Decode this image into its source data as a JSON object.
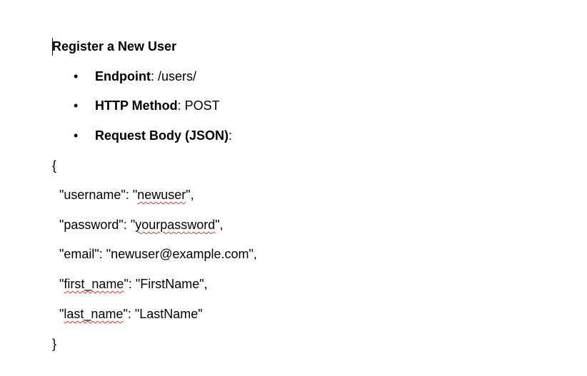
{
  "document": {
    "heading": "Register a New User",
    "bullets": [
      {
        "label": "Endpoint",
        "value": ": /users/"
      },
      {
        "label": "HTTP Method",
        "value": ": POST"
      },
      {
        "label": "Request Body (JSON)",
        "value": ":"
      }
    ],
    "json_block": {
      "open_brace": "{",
      "line1": {
        "pre": "  \"username\": \"",
        "spell": "newuser",
        "post": "\","
      },
      "line2": {
        "pre": "  \"password\": \"",
        "spell": "yourpassword",
        "post": "\","
      },
      "line3": {
        "text": "  \"email\": \"newuser@example.com\","
      },
      "line4": {
        "pre": "  \"",
        "spell": "first_name",
        "post": "\": \"FirstName\","
      },
      "line5": {
        "pre": "  \"",
        "spell": "last_name",
        "post": "\": \"LastName\""
      },
      "close_brace": "}"
    }
  }
}
